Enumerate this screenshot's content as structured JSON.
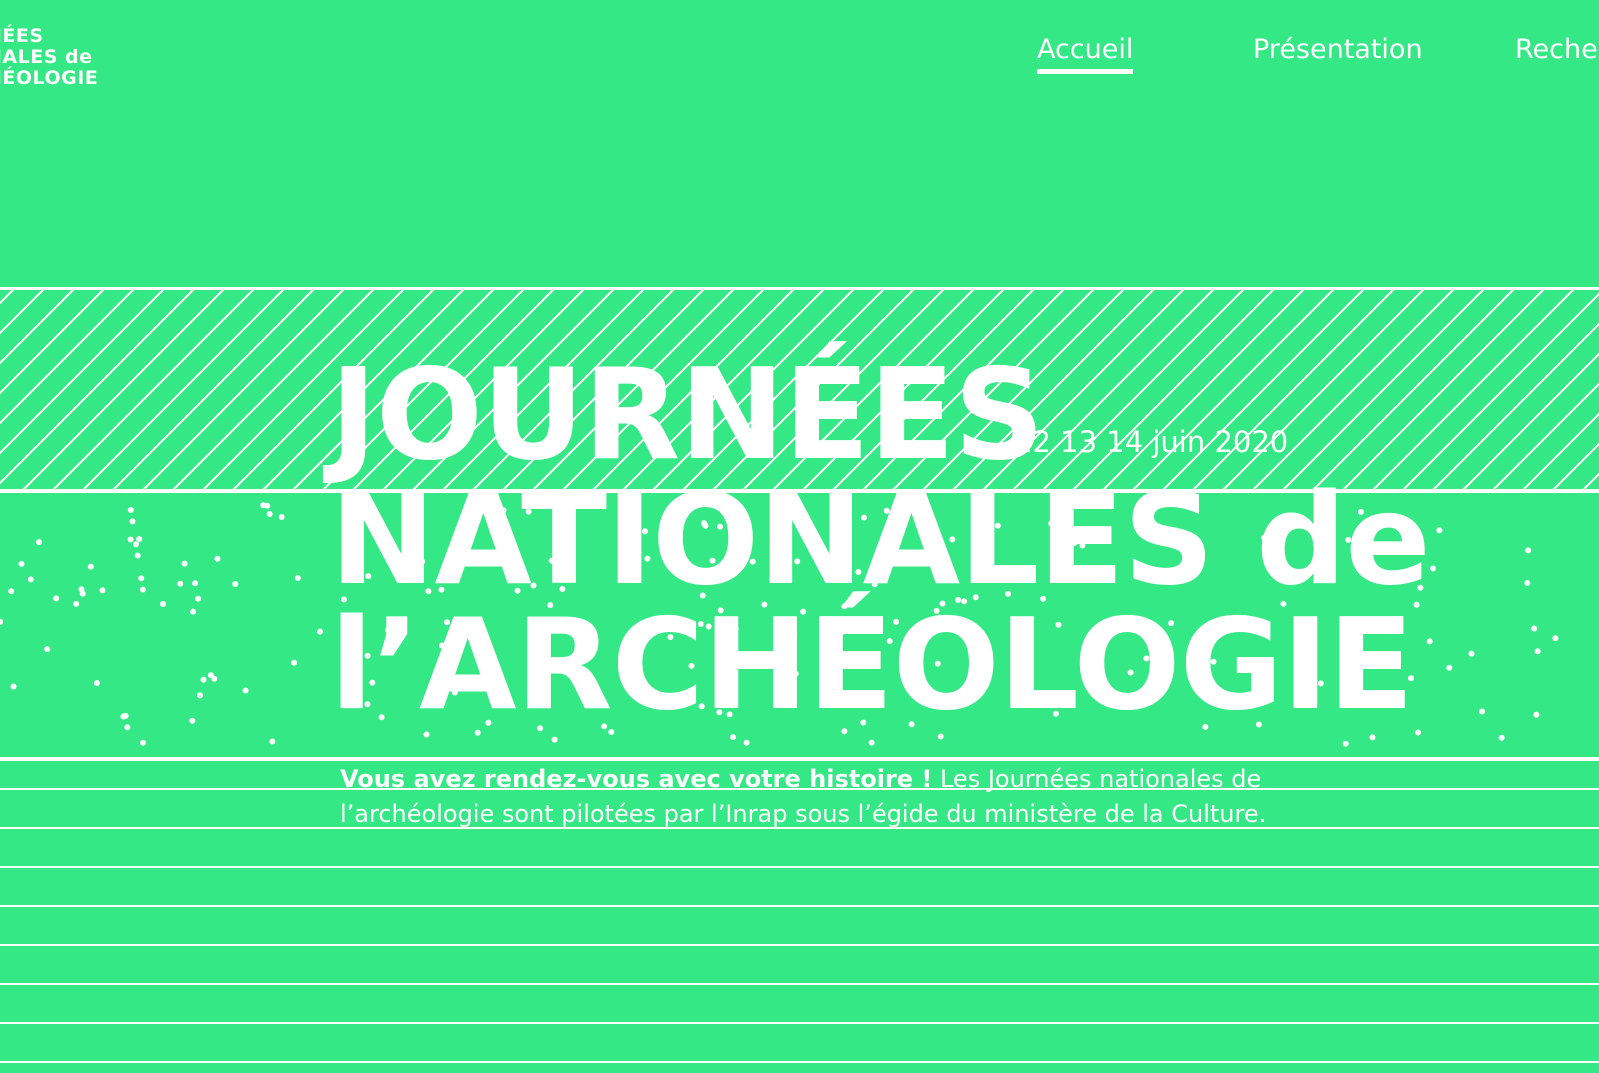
{
  "logo": {
    "line1": "NÉES",
    "line2": "NALES de",
    "line3": "HÉOLOGIE"
  },
  "nav": {
    "items": [
      {
        "label": "Accueil",
        "active": true
      },
      {
        "label": "Présentation",
        "active": false
      },
      {
        "label": "Reche",
        "active": false
      }
    ]
  },
  "hero": {
    "title_line1": "JOURNÉES",
    "title_line2": "NATIONALES de",
    "title_line3": "l’ARCHÉOLOGIE",
    "date": "12 13 14 juin 2020",
    "intro_bold": "Vous avez rendez-vous avec votre histoire !",
    "intro_text": " Les Journées nationales de l’archéologie sont pilotées par l’Inrap sous l’égide du ministère de la Culture."
  },
  "colors": {
    "background": "#33e885",
    "foreground": "#ffffff"
  }
}
